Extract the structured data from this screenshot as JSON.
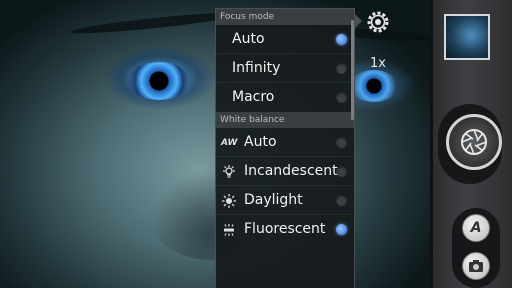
{
  "camera": {
    "zoom_label": "1x"
  },
  "settings_menu": {
    "focus_header": "Focus mode",
    "focus_options": [
      {
        "label": "Auto",
        "selected": true
      },
      {
        "label": "Infinity",
        "selected": false
      },
      {
        "label": "Macro",
        "selected": false
      }
    ],
    "wb_header": "White balance",
    "wb_options": [
      {
        "label": "Auto",
        "icon": "auto-wb-icon",
        "selected": false
      },
      {
        "label": "Incandescent",
        "icon": "incandescent-icon",
        "selected": false
      },
      {
        "label": "Daylight",
        "icon": "daylight-icon",
        "selected": false
      },
      {
        "label": "Fluorescent",
        "icon": "fluorescent-icon",
        "selected": true
      }
    ]
  },
  "controls": {
    "accent_color": "#4f86e6",
    "icons": [
      "settings-gear-icon",
      "gallery-thumbnail",
      "shutter-icon",
      "auto-mode-icon",
      "camera-mode-icon"
    ]
  }
}
